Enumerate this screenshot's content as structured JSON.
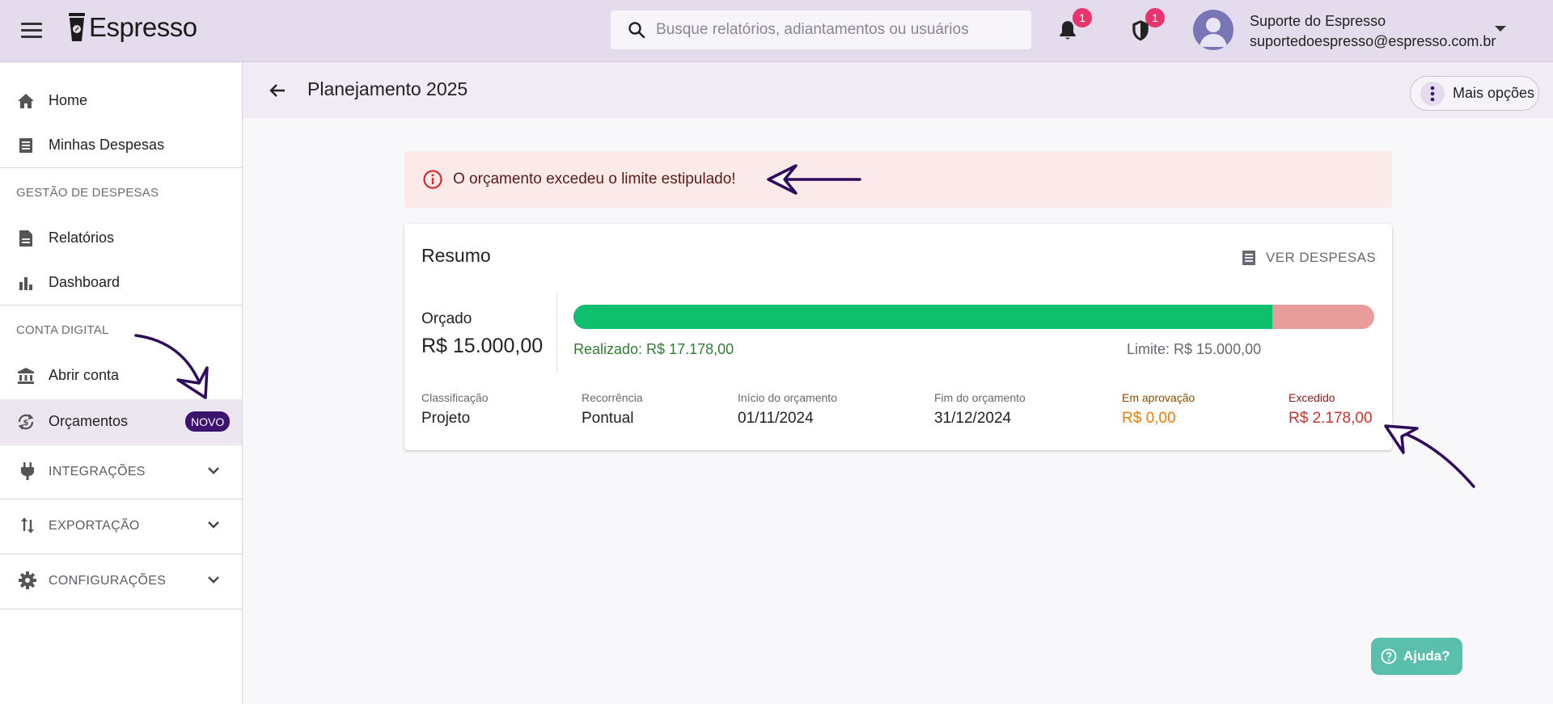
{
  "app": {
    "name": "Espresso"
  },
  "search": {
    "placeholder": "Busque relatórios, adiantamentos ou usuários"
  },
  "header": {
    "notifications_count": "1",
    "security_count": "1",
    "user_name": "Suporte do Espresso",
    "user_email": "suportedoespresso@espresso.com.br"
  },
  "sidebar": {
    "items": [
      {
        "label": "Home",
        "icon": "home-icon"
      },
      {
        "label": "Minhas Despesas",
        "icon": "receipt-icon"
      }
    ],
    "section_expenses": "GESTÃO DE DESPESAS",
    "expense_items": [
      {
        "label": "Relatórios",
        "icon": "document-icon"
      },
      {
        "label": "Dashboard",
        "icon": "bar-chart-icon"
      }
    ],
    "section_account": "CONTA DIGITAL",
    "account_items": [
      {
        "label": "Abrir conta",
        "icon": "bank-icon"
      },
      {
        "label": "Orçamentos",
        "icon": "budget-icon",
        "badge": "NOVO",
        "active": true
      }
    ],
    "groups": [
      {
        "label": "INTEGRAÇÕES",
        "icon": "plug-icon"
      },
      {
        "label": "EXPORTAÇÃO",
        "icon": "sort-arrows-icon"
      },
      {
        "label": "CONFIGURAÇÕES",
        "icon": "gear-icon"
      }
    ]
  },
  "page": {
    "title": "Planejamento 2025",
    "more_options": "Mais opções"
  },
  "alert": {
    "text": "O orçamento excedeu o limite estipulado!"
  },
  "summary": {
    "title": "Resumo",
    "view_expenses": "VER DESPESAS",
    "budgeted_label": "Orçado",
    "budgeted_value": "R$ 15.000,00",
    "realized_text": "Realizado: R$ 17.178,00",
    "limit_text": "Limite: R$ 15.000,00",
    "progress_realized_fraction": 0.8727,
    "meta": [
      {
        "label": "Classificação",
        "value": "Projeto",
        "tone": "normal"
      },
      {
        "label": "Recorrência",
        "value": "Pontual",
        "tone": "normal"
      },
      {
        "label": "Início do orçamento",
        "value": "01/11/2024",
        "tone": "normal"
      },
      {
        "label": "Fim do orçamento",
        "value": "31/12/2024",
        "tone": "normal"
      },
      {
        "label": "Em aprovação",
        "value": "R$ 0,00",
        "tone": "warn"
      },
      {
        "label": "Excedido",
        "value": "R$ 2.178,00",
        "tone": "danger"
      }
    ]
  },
  "help": {
    "label": "Ajuda?"
  },
  "colors": {
    "topbar": "#e4dcec",
    "brand_purple": "#3d1370",
    "progress_ok": "#0ebf6e",
    "progress_over": "#e89c9c",
    "danger": "#d32f2f",
    "warn": "#ef7c00",
    "help": "#5bbfae"
  }
}
